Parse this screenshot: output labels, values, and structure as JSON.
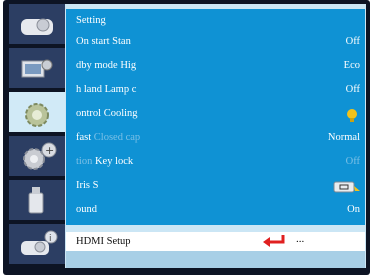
{
  "menu": {
    "title": "Setting",
    "rows": [
      {
        "label": "On  start  Stan",
        "value": "Off",
        "value_dim": false
      },
      {
        "label": "dby mode  Hig",
        "value": "Eco",
        "value_dim": false
      },
      {
        "label": "h land  Lamp c",
        "value": "Off",
        "value_dim": false
      },
      {
        "label": "ontrol  Cooling",
        "value": "",
        "value_dim": false,
        "value_icon": "bulb-icon"
      },
      {
        "label_pre": "fast",
        "label_dim": "Closed cap",
        "value": "Normal",
        "value_dim": false
      },
      {
        "label_dim_pre": "tion",
        "label": "Key lock",
        "value": "Off",
        "value_dim": true
      },
      {
        "label": "Iris  S",
        "value": "",
        "value_dim": false,
        "value_icon": "key-pointer-icon"
      },
      {
        "label": "ound",
        "value": "On",
        "value_dim": false
      }
    ],
    "hdmi": {
      "label": "HDMI Setup",
      "ellipsis": "...",
      "icon": "enter-arrow-icon"
    }
  },
  "sidebar": {
    "tabs": [
      {
        "name": "projector-icon"
      },
      {
        "name": "image-setting-icon"
      },
      {
        "name": "gear-icon",
        "active": true
      },
      {
        "name": "gear-plus-icon"
      },
      {
        "name": "usb-icon"
      },
      {
        "name": "projector-info-icon"
      }
    ]
  },
  "colors": {
    "main_bg": "#0f92d4",
    "panel_bg": "#cbe6f5",
    "sidebar_tab": "#2c3e63",
    "enter_arrow": "#e02020",
    "bulb": "#f2c21a"
  }
}
